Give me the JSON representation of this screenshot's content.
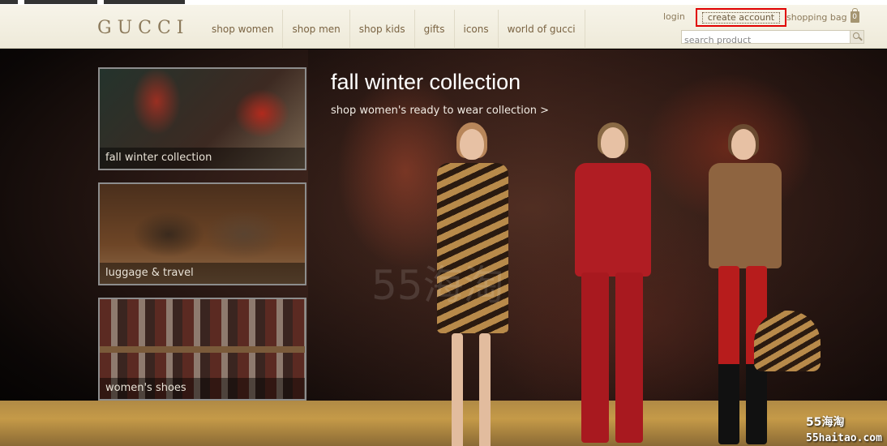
{
  "header": {
    "logo": "GUCCI",
    "nav": [
      "shop women",
      "shop men",
      "shop kids",
      "gifts",
      "icons",
      "world of gucci"
    ],
    "login": "login",
    "create_account": "create account",
    "shopping_bag": "shopping bag",
    "bag_count": "0",
    "search_placeholder": "search product"
  },
  "hero": {
    "title": "fall winter collection",
    "link": "shop women's ready to wear collection >"
  },
  "thumbnails": [
    {
      "caption": "fall winter collection"
    },
    {
      "caption": "luggage & travel"
    },
    {
      "caption": "women's shoes"
    }
  ],
  "watermark": {
    "center": "55海淘",
    "corner_line1": "55海淘",
    "corner_line2": "55haitao.com"
  },
  "colors": {
    "highlight": "#e00000",
    "nav_text": "#7a6342",
    "header_bg": "#f3f0e3"
  }
}
